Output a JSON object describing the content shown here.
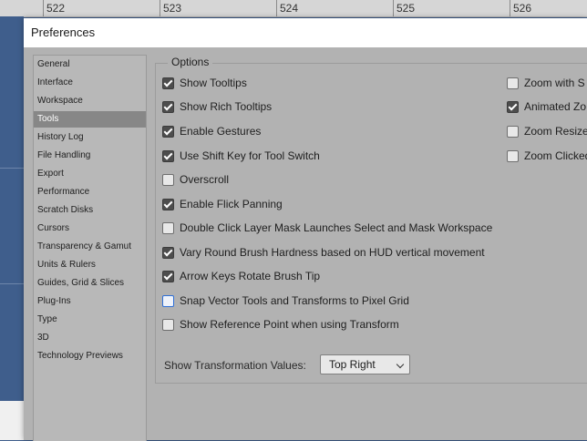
{
  "ruler": {
    "ticks": [
      "522",
      "523",
      "524",
      "525",
      "526"
    ]
  },
  "dialog": {
    "title": "Preferences"
  },
  "sidebar": {
    "items": [
      {
        "label": "General",
        "selected": false
      },
      {
        "label": "Interface",
        "selected": false
      },
      {
        "label": "Workspace",
        "selected": false
      },
      {
        "label": "Tools",
        "selected": true
      },
      {
        "label": "History Log",
        "selected": false
      },
      {
        "label": "File Handling",
        "selected": false
      },
      {
        "label": "Export",
        "selected": false
      },
      {
        "label": "Performance",
        "selected": false
      },
      {
        "label": "Scratch Disks",
        "selected": false
      },
      {
        "label": "Cursors",
        "selected": false
      },
      {
        "label": "Transparency & Gamut",
        "selected": false
      },
      {
        "label": "Units & Rulers",
        "selected": false
      },
      {
        "label": "Guides, Grid & Slices",
        "selected": false
      },
      {
        "label": "Plug-Ins",
        "selected": false
      },
      {
        "label": "Type",
        "selected": false
      },
      {
        "label": "3D",
        "selected": false
      },
      {
        "label": "Technology Previews",
        "selected": false
      }
    ]
  },
  "options": {
    "legend": "Options",
    "left": [
      {
        "label": "Show Tooltips",
        "checked": true
      },
      {
        "label": "Show Rich Tooltips",
        "checked": true
      },
      {
        "label": "Enable Gestures",
        "checked": true
      },
      {
        "label": "Use Shift Key for Tool Switch",
        "checked": true
      },
      {
        "label": "Overscroll",
        "checked": false
      },
      {
        "label": "Enable Flick Panning",
        "checked": true
      },
      {
        "label": "Double Click Layer Mask Launches Select and Mask Workspace",
        "checked": false
      },
      {
        "label": "Vary Round Brush Hardness based on HUD vertical movement",
        "checked": true
      },
      {
        "label": "Arrow Keys Rotate Brush Tip",
        "checked": true
      },
      {
        "label": "Snap Vector Tools and Transforms to Pixel Grid",
        "checked": false,
        "focused": true
      },
      {
        "label": "Show Reference Point when using Transform",
        "checked": false
      }
    ],
    "right": [
      {
        "label": "Zoom with S",
        "checked": false
      },
      {
        "label": "Animated Zo",
        "checked": true
      },
      {
        "label": "Zoom Resize",
        "checked": false
      },
      {
        "label": "Zoom Clicked",
        "checked": false
      }
    ]
  },
  "transformation": {
    "label": "Show Transformation Values:",
    "selected": "Top Right"
  }
}
